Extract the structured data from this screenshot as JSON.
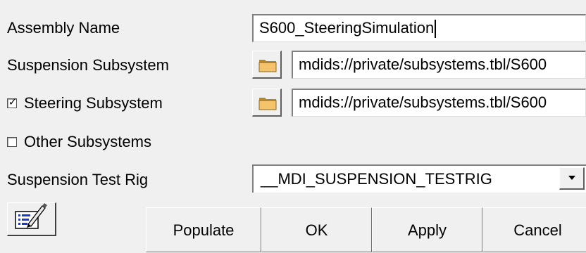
{
  "form": {
    "assembly_name_label": "Assembly Name",
    "assembly_name_value": "S600_SteeringSimulation",
    "suspension_subsystem_label": "Suspension Subsystem",
    "suspension_subsystem_value": "mdids://private/subsystems.tbl/S600",
    "steering_subsystem_label": "Steering Subsystem",
    "steering_subsystem_checked": true,
    "steering_subsystem_check_glyph": "✓",
    "steering_subsystem_value": "mdids://private/subsystems.tbl/S600",
    "other_subsystems_label": "Other Subsystems",
    "other_subsystems_checked": false,
    "test_rig_label": "Suspension Test Rig",
    "test_rig_value": "__MDI_SUSPENSION_TESTRIG"
  },
  "buttons": {
    "populate": "Populate",
    "ok": "OK",
    "apply": "Apply",
    "cancel": "Cancel"
  },
  "icons": {
    "folder": "folder-icon",
    "dropdown": "triangle-down-icon",
    "edit_list": "edit-list-icon"
  },
  "colors": {
    "background": "#f0f0f0",
    "folder_fill": "#f5c36b",
    "folder_dark": "#b8862a"
  }
}
